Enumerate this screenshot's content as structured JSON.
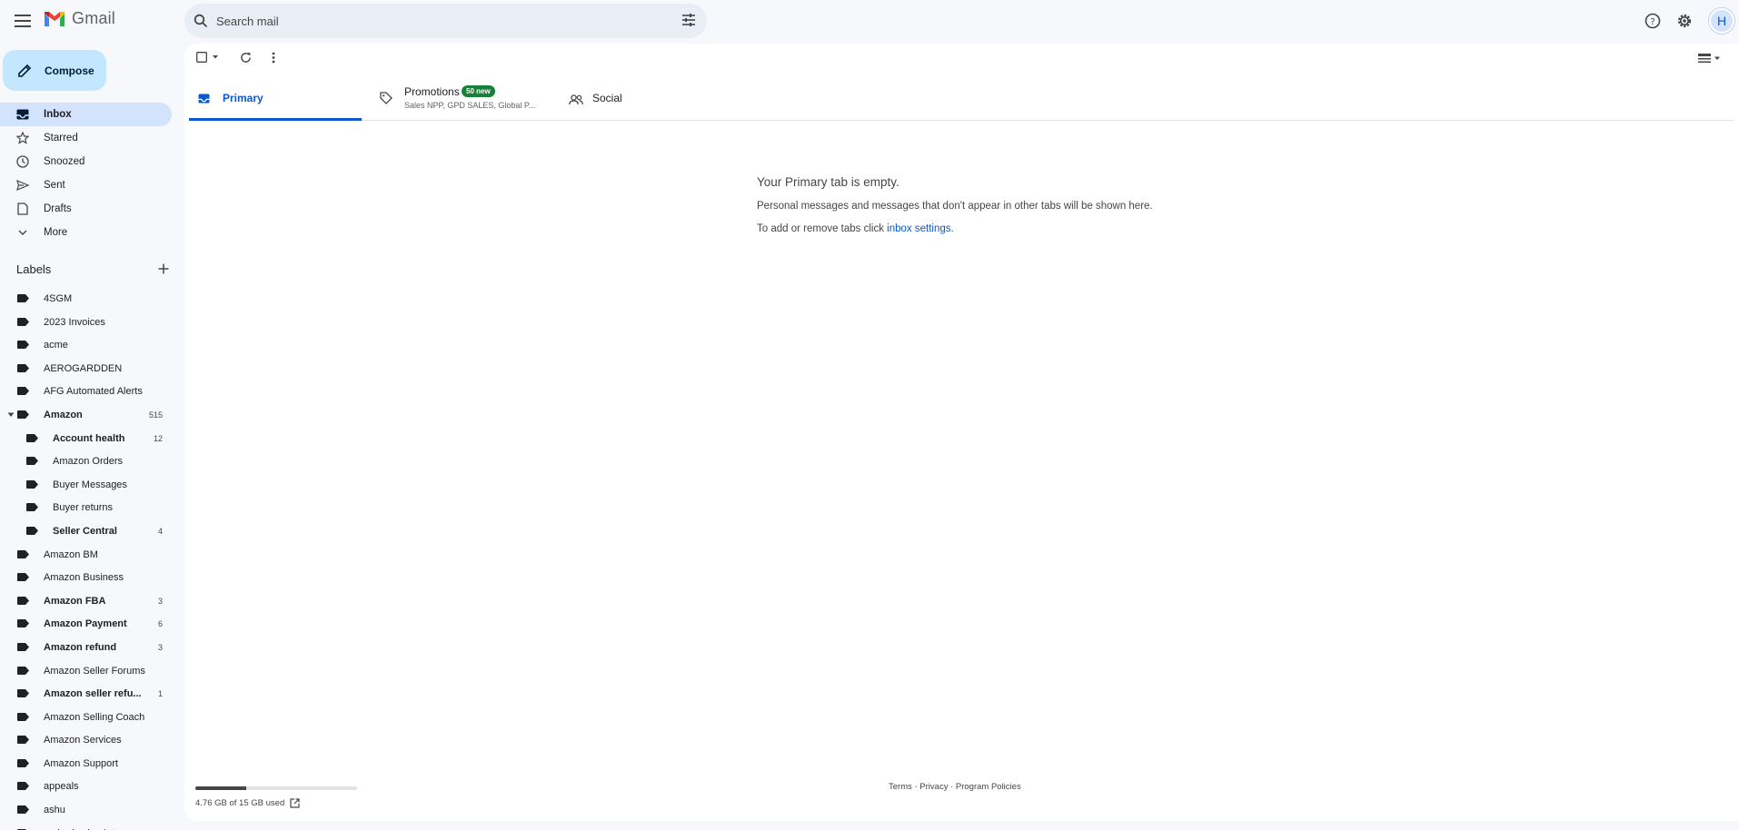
{
  "header": {
    "app_name": "Gmail",
    "search_placeholder": "Search mail",
    "avatar_initial": "H"
  },
  "compose_label": "Compose",
  "nav": [
    {
      "label": "Inbox",
      "icon": "inbox-icon",
      "active": true
    },
    {
      "label": "Starred",
      "icon": "star-icon"
    },
    {
      "label": "Snoozed",
      "icon": "clock-icon"
    },
    {
      "label": "Sent",
      "icon": "send-icon"
    },
    {
      "label": "Drafts",
      "icon": "draft-icon"
    },
    {
      "label": "More",
      "icon": "chevron-down-icon"
    }
  ],
  "labels_title": "Labels",
  "labels": [
    {
      "name": "4SGM"
    },
    {
      "name": "2023 Invoices"
    },
    {
      "name": "acme"
    },
    {
      "name": "AEROGARDDEN"
    },
    {
      "name": "AFG Automated Alerts"
    },
    {
      "name": "Amazon",
      "count": "515",
      "bold": true,
      "expanded": true
    },
    {
      "name": "Account health",
      "count": "12",
      "bold": true,
      "sub": true
    },
    {
      "name": "Amazon Orders",
      "sub": true
    },
    {
      "name": "Buyer Messages",
      "sub": true
    },
    {
      "name": "Buyer returns",
      "sub": true
    },
    {
      "name": "Seller Central",
      "count": "4",
      "bold": true,
      "sub": true
    },
    {
      "name": "Amazon BM"
    },
    {
      "name": "Amazon Business"
    },
    {
      "name": "Amazon FBA",
      "count": "3",
      "bold": true
    },
    {
      "name": "Amazon Payment",
      "count": "6",
      "bold": true
    },
    {
      "name": "Amazon refund",
      "count": "3",
      "bold": true
    },
    {
      "name": "Amazon Seller Forums"
    },
    {
      "name": "Amazon seller refu...",
      "count": "1",
      "bold": true
    },
    {
      "name": "Amazon Selling Coach"
    },
    {
      "name": "Amazon Services"
    },
    {
      "name": "Amazon Support"
    },
    {
      "name": "appeals"
    },
    {
      "name": "ashu"
    },
    {
      "name": "authorization letter"
    }
  ],
  "tabs": {
    "primary": "Primary",
    "promotions": "Promotions",
    "promotions_badge": "50 new",
    "promotions_sub": "Sales NPP, GPD SALES, Global P...",
    "social": "Social"
  },
  "empty_state": {
    "title": "Your Primary tab is empty.",
    "line1": "Personal messages and messages that don't appear in other tabs will be shown here.",
    "line2_prefix": "To add or remove tabs click ",
    "line2_link": "inbox settings",
    "line2_suffix": "."
  },
  "storage": {
    "text": "4.76 GB of 15 GB used",
    "fraction": 0.317
  },
  "footer": {
    "links_text": "Terms · Privacy · Program Policies"
  },
  "colors": {
    "compose_bg": "#c2e7ff",
    "active_nav": "#d3e3fd",
    "accent": "#0b57d0",
    "badge": "#188038"
  }
}
